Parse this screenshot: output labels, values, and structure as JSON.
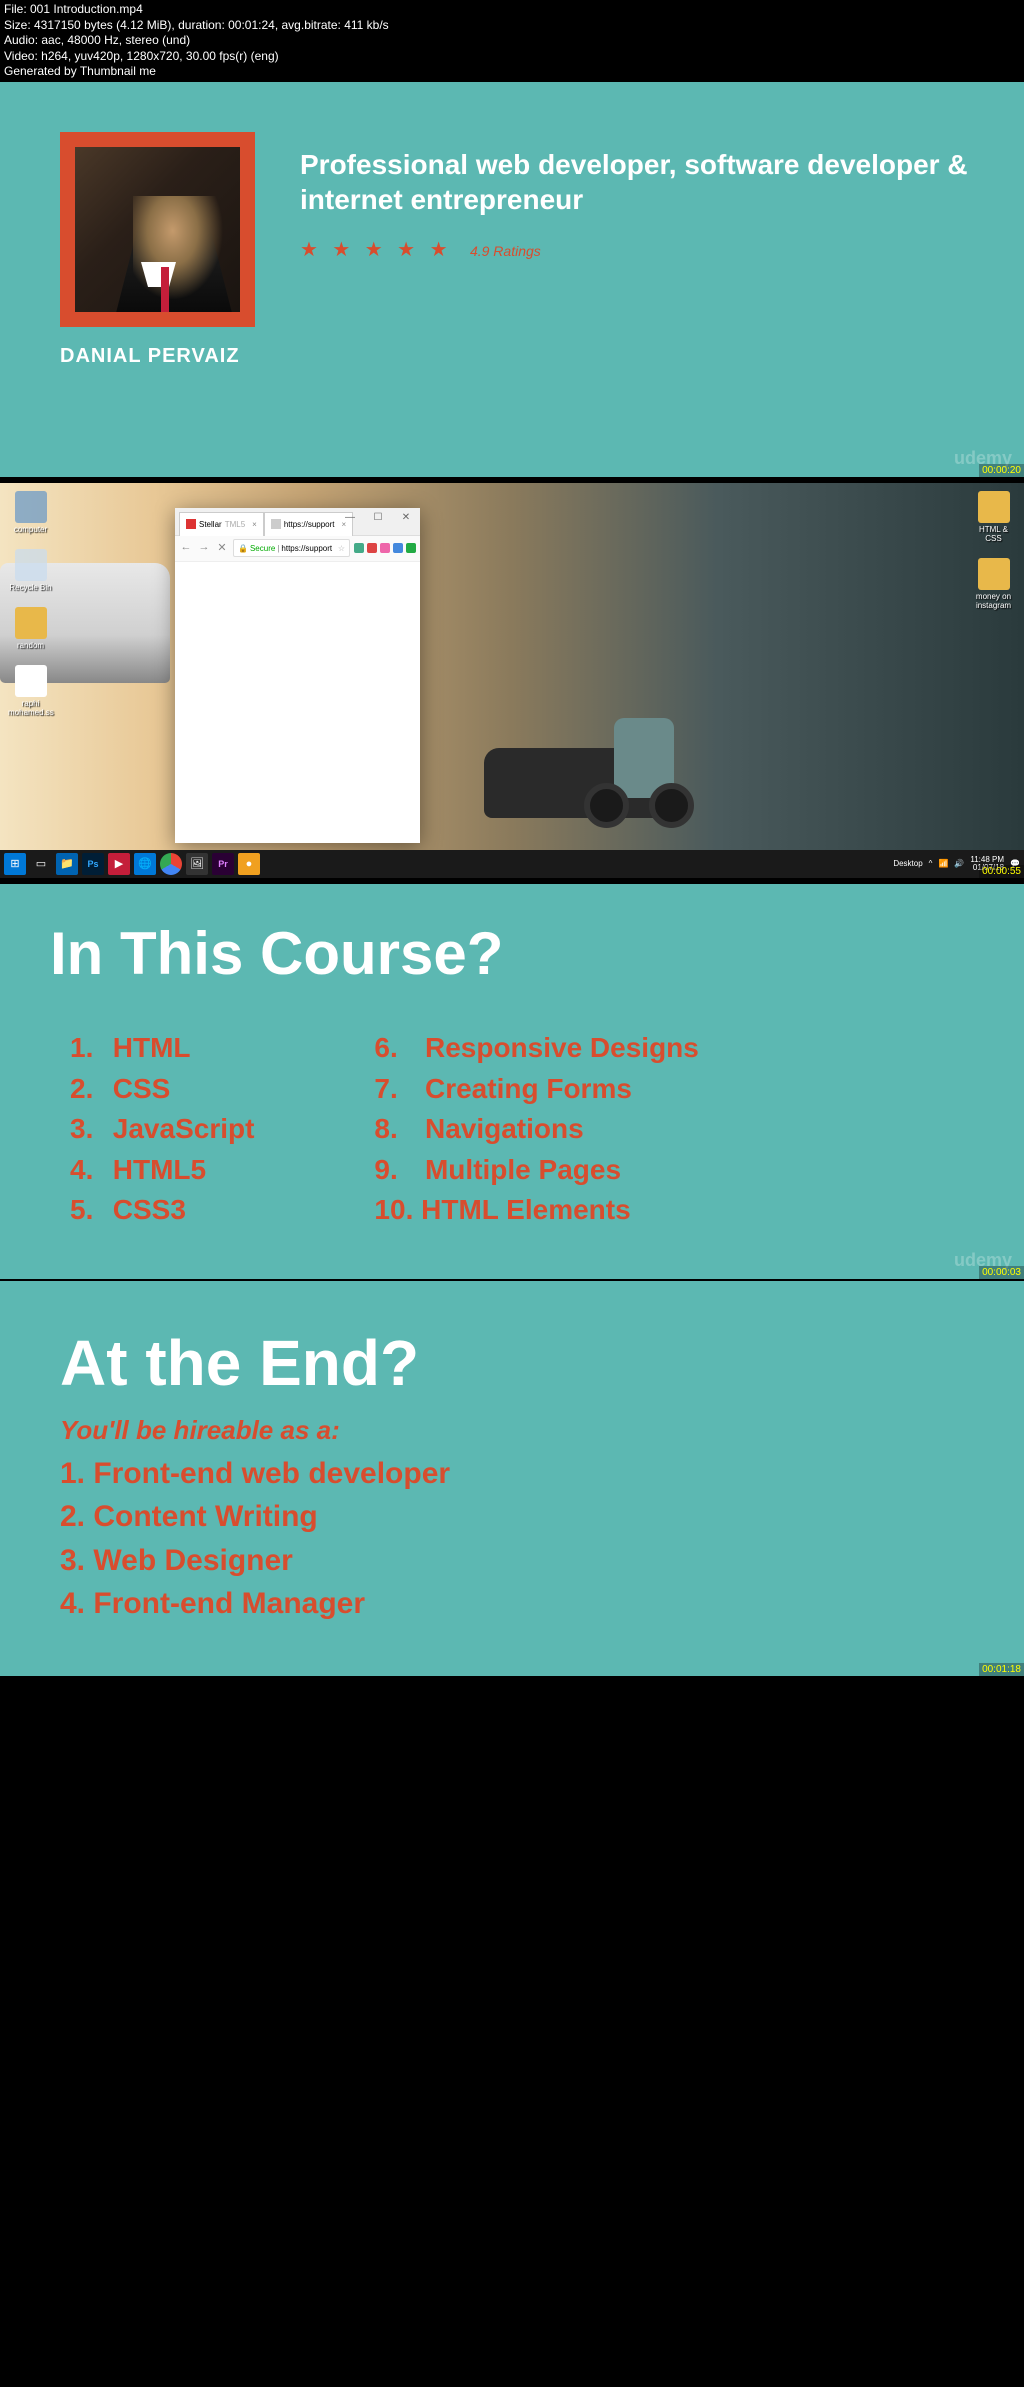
{
  "meta": {
    "line1": "File: 001 Introduction.mp4",
    "line2": "Size: 4317150 bytes (4.12 MiB), duration: 00:01:24, avg.bitrate: 411 kb/s",
    "line3": "Audio: aac, 48000 Hz, stereo (und)",
    "line4": "Video: h264, yuv420p, 1280x720, 30.00 fps(r) (eng)",
    "line5": "Generated by Thumbnail me"
  },
  "panel1": {
    "instructor": "DANIAL PERVAIZ",
    "headline": "Professional web developer, software developer & internet entrepreneur",
    "rating": "4.9 Ratings",
    "watermark": "udemy",
    "timestamp": "00:00:20"
  },
  "panel2": {
    "icons_left": [
      {
        "label": "computer"
      },
      {
        "label": "Recycle Bin"
      },
      {
        "label": "random"
      },
      {
        "label": "raphi mohamed.ss"
      }
    ],
    "icons_right": [
      {
        "label": "HTML & CSS"
      },
      {
        "label": "money on instagram"
      }
    ],
    "browser": {
      "tab1": "Stellar",
      "tab1_suffix": "TML5",
      "tab2": "https://support",
      "secure_label": "Secure",
      "url": "https://support"
    },
    "win_controls": {
      "min": "—",
      "max": "☐",
      "close": "✕"
    },
    "taskbar": {
      "desktop_label": "Desktop",
      "time": "11:48 PM",
      "date": "01/07/18"
    },
    "timestamp": "00:00:55"
  },
  "panel3": {
    "title": "In This Course?",
    "left_items": [
      "HTML",
      "CSS",
      "JavaScript",
      "HTML5",
      "CSS3"
    ],
    "right_items": [
      "Responsive Designs",
      "Creating Forms",
      "Navigations",
      "Multiple Pages",
      "HTML Elements"
    ],
    "watermark": "udemy",
    "timestamp": "00:00:03"
  },
  "panel4": {
    "title": "At the End?",
    "subtitle": "You'll be hireable as a:",
    "items": [
      "Front-end web developer",
      "Content Writing",
      "Web Designer",
      "Front-end Manager"
    ],
    "timestamp": "00:01:18"
  }
}
